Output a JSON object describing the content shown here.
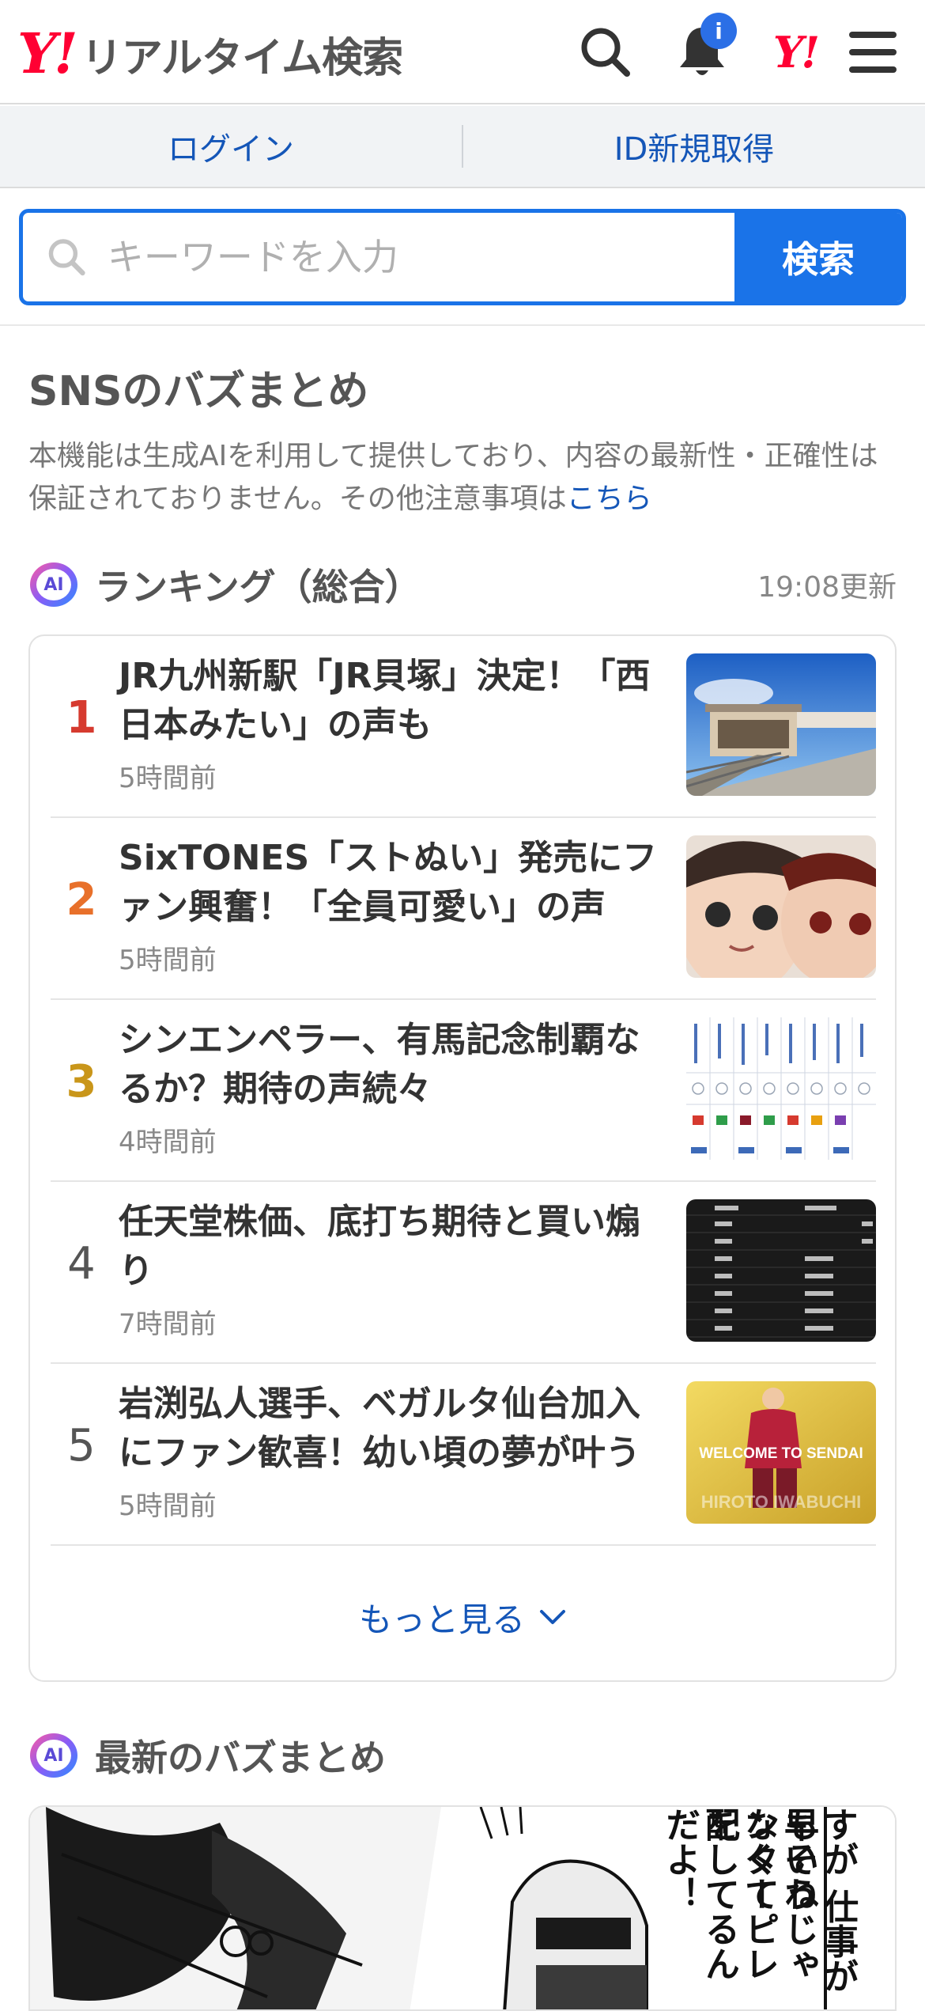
{
  "header": {
    "logo_mark": "Y!",
    "logo_text": "リアルタイム検索",
    "notification_badge": "i",
    "yahoo_mark": "Y!"
  },
  "auth": {
    "login": "ログイン",
    "signup": "ID新規取得"
  },
  "search": {
    "placeholder": "キーワードを入力",
    "button": "検索"
  },
  "sns": {
    "title": "SNSのバズまとめ",
    "notice": "本機能は生成AIを利用して提供しており、内容の最新性・正確性は保証されておりません。その他注意事項は",
    "notice_link": "こちら"
  },
  "ranking": {
    "badge": "AI",
    "title": "ランキング（総合）",
    "updated": "19:08更新",
    "items": [
      {
        "rank": "1",
        "title": "JR九州新駅「JR貝塚」決定！「西日本みたい」の声も",
        "time": "5時間前",
        "rank_color": "#d63a2f"
      },
      {
        "rank": "2",
        "title": "SixTONES「ストぬい」発売にファン興奮！「全員可愛い」の声",
        "time": "5時間前",
        "rank_color": "#e8702a"
      },
      {
        "rank": "3",
        "title": "シンエンペラー、有馬記念制覇なるか？期待の声続々",
        "time": "4時間前",
        "rank_color": "#c9961a"
      },
      {
        "rank": "4",
        "title": "任天堂株価、底打ち期待と買い煽り",
        "time": "7時間前",
        "rank_color": "#555555"
      },
      {
        "rank": "5",
        "title": "岩渕弘人選手、ベガルタ仙台加入にファン歓喜！幼い頃の夢が叶う",
        "time": "5時間前",
        "rank_color": "#555555"
      }
    ],
    "more": "もっと見る"
  },
  "thumb_text": {
    "welcome": "WELCOME TO SENDAI",
    "name": "HIROTO IWABUCHI"
  },
  "latest": {
    "badge": "AI",
    "title": "最新のバズまとめ",
    "manga_lines": [
      "すが 仕事が早いね",
      "もそうじゃなくて",
      "ンターピレを",
      "配してるんだよ！"
    ]
  }
}
